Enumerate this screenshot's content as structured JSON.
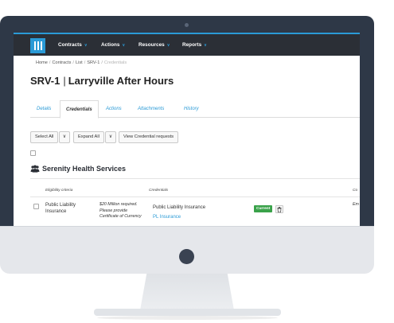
{
  "nav": {
    "items": [
      {
        "label": "Contracts"
      },
      {
        "label": "Actions"
      },
      {
        "label": "Resources"
      },
      {
        "label": "Reports"
      }
    ]
  },
  "breadcrumb": {
    "items": [
      "Home",
      "Contracts",
      "List",
      "SRV-1"
    ],
    "current": "Credentials",
    "separator": "/"
  },
  "page": {
    "id": "SRV-1",
    "separator": "|",
    "name": "Larryville After Hours"
  },
  "tabs": [
    {
      "label": "Details",
      "active": false
    },
    {
      "label": "Credentials",
      "active": true
    },
    {
      "label": "Actions",
      "active": false
    },
    {
      "label": "Attachments",
      "active": false
    },
    {
      "label": "History",
      "active": false
    }
  ],
  "toolbar": {
    "select_all": "Select All",
    "expand_all": "Expand All",
    "view_requests": "View Credential requests"
  },
  "organization": {
    "name": "Serenity Health Services"
  },
  "table": {
    "headers": {
      "eligibility": "Eligibility criteria",
      "credentials": "Credentials",
      "truncated": "Co"
    },
    "rows": [
      {
        "criteria": "Public Liability Insurance",
        "note": "$20 Million required. Please provide Certificate of Currency",
        "credential": "Public Liability Insurance",
        "credential_link": "PL Insurance",
        "status": "Current",
        "trailing": "Em"
      }
    ]
  },
  "colors": {
    "accent": "#2a9ad6",
    "navbar": "#2b2f36",
    "status_current": "#3aa24a",
    "bezel": "#2e3847"
  }
}
